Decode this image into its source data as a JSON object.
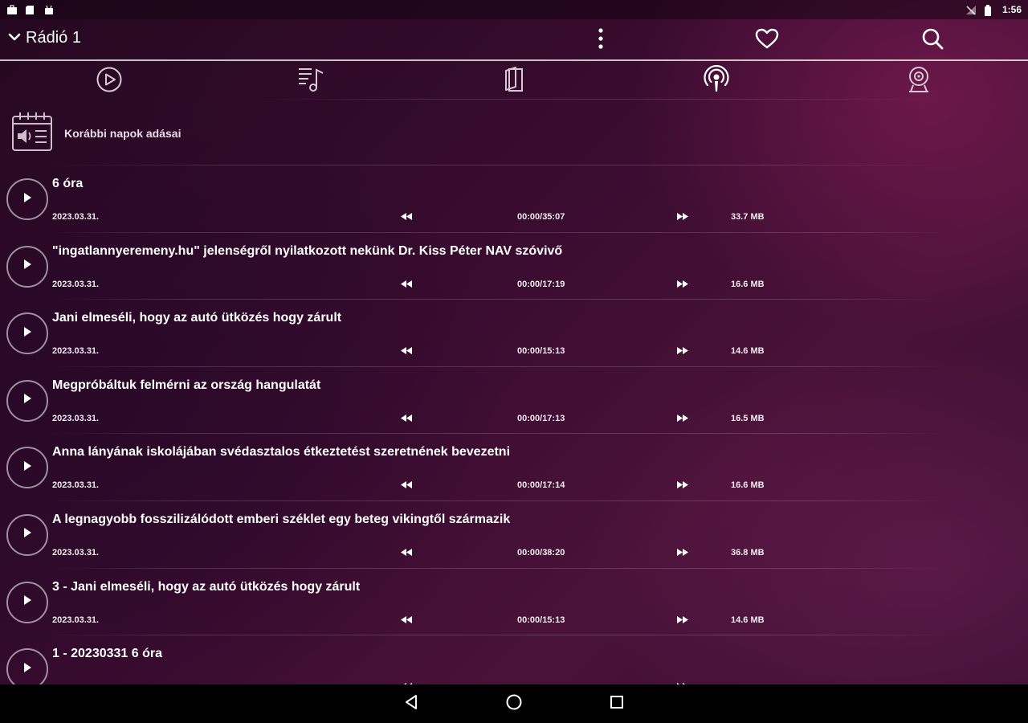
{
  "status_bar": {
    "left_icons": [
      "briefcase-icon",
      "sd-card-icon",
      "android-icon"
    ],
    "right_icons": [
      "no-signal-icon",
      "battery-icon"
    ],
    "time": "1:56"
  },
  "app_bar": {
    "station_name": "Rádió 1",
    "actions": [
      "more-vert-icon",
      "heart-icon",
      "search-icon"
    ]
  },
  "tabs": [
    {
      "name": "play-circle-icon"
    },
    {
      "name": "playlist-music-icon"
    },
    {
      "name": "book-icon"
    },
    {
      "name": "podcast-icon",
      "selected": true
    },
    {
      "name": "webcam-icon"
    }
  ],
  "previous_days": {
    "label": "Korábbi napok adásai"
  },
  "episodes": [
    {
      "title": "6 óra",
      "date": "2023.03.31.",
      "time": "00:00/35:07",
      "size": "33.7 MB"
    },
    {
      "title": "\"ingatlannyeremeny.hu\" jelenségről nyilatkozott nekünk Dr. Kiss Péter NAV szóvivő",
      "date": "2023.03.31.",
      "time": "00:00/17:19",
      "size": "16.6 MB"
    },
    {
      "title": "Jani elmeséli, hogy az autó ütközés hogy zárult",
      "date": "2023.03.31.",
      "time": "00:00/15:13",
      "size": "14.6 MB"
    },
    {
      "title": "Megpróbáltuk felmérni az ország hangulatát",
      "date": "2023.03.31.",
      "time": "00:00/17:13",
      "size": "16.5 MB"
    },
    {
      "title": "Anna lányának iskolájában svédasztalos étkeztetést szeretnének bevezetni",
      "date": "2023.03.31.",
      "time": "00:00/17:14",
      "size": "16.6 MB"
    },
    {
      "title": "A legnagyobb fosszilizálódott emberi széklet egy beteg vikingtől származik",
      "date": "2023.03.31.",
      "time": "00:00/38:20",
      "size": "36.8 MB"
    },
    {
      "title": "3 - Jani elmeséli, hogy az autó ütközés hogy zárult",
      "date": "2023.03.31.",
      "time": "00:00/15:13",
      "size": "14.6 MB"
    },
    {
      "title": "1 - 20230331 6 óra",
      "date": "",
      "time": "",
      "size": ""
    }
  ],
  "nav_bar": {
    "buttons": [
      "back-icon",
      "home-icon",
      "recents-icon"
    ]
  },
  "colors": {
    "background_dark": "#25081f",
    "background_accent": "#4a1238",
    "text": "#ffffff"
  }
}
